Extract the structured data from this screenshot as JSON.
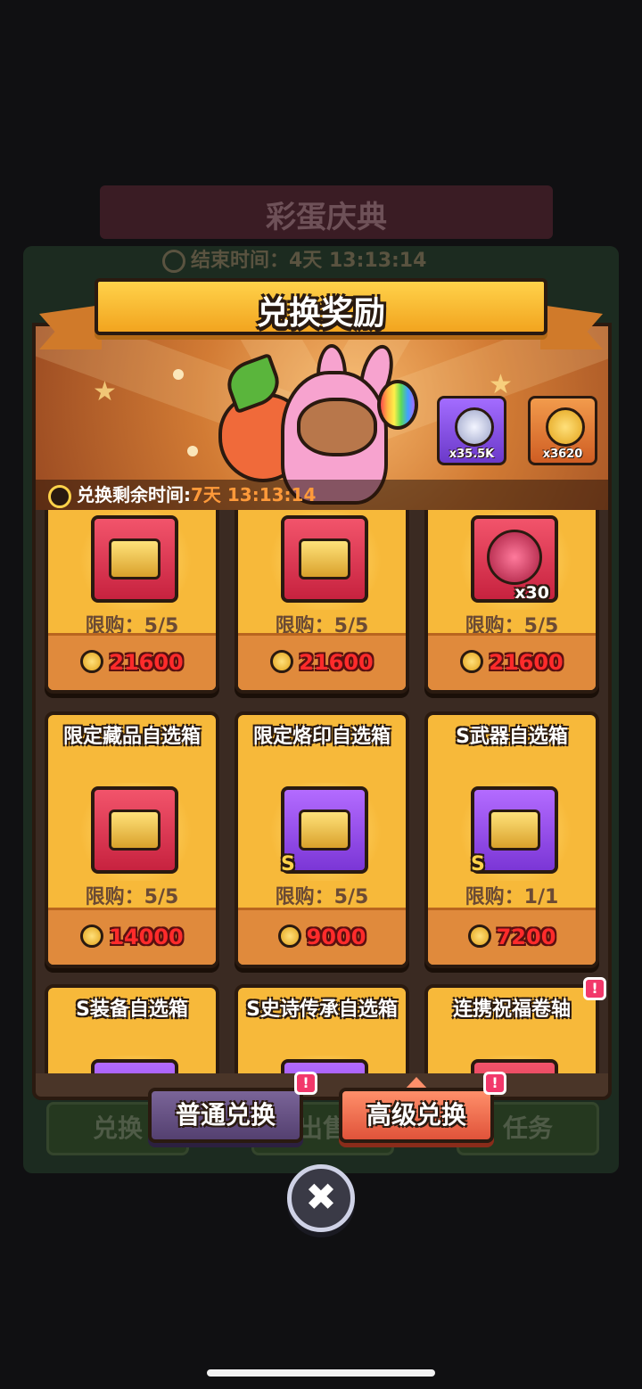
{
  "background": {
    "event_title": "彩蛋庆典",
    "end_time_label": "结束时间：4天 13:13:14",
    "tabs": [
      "兑换",
      "出售",
      "任务"
    ]
  },
  "modal": {
    "title": "兑换奖励",
    "currencies": [
      {
        "icon": "silver-rabbit-coin-icon",
        "amount": "x35.5K"
      },
      {
        "icon": "gold-rabbit-coin-icon",
        "amount": "x3620"
      }
    ],
    "exchange_timer": {
      "label": "兑换剩余时间:",
      "value": "7天 13:13:14"
    }
  },
  "items": [
    {
      "name": "",
      "icon": "collectible-chest-icon",
      "box": "red",
      "badge": "",
      "limit": "限购：5/5",
      "price": "21600"
    },
    {
      "name": "",
      "icon": "collectible-chest-icon",
      "box": "red",
      "badge": "",
      "limit": "限购：5/5",
      "price": "21600"
    },
    {
      "name": "",
      "icon": "orb-token-icon",
      "box": "red",
      "badge": "x30",
      "limit": "限购：5/5",
      "price": "21600"
    },
    {
      "name": "限定藏品自选箱",
      "icon": "limited-collectible-chest-icon",
      "box": "red",
      "badge": "",
      "limit": "限购：5/5",
      "price": "14000"
    },
    {
      "name": "限定烙印自选箱",
      "icon": "limited-brand-chest-icon",
      "box": "purple",
      "badge": "S",
      "limit": "限购：5/5",
      "price": "9000"
    },
    {
      "name": "S武器自选箱",
      "icon": "weapon-chest-icon",
      "box": "purple",
      "badge": "S",
      "limit": "限购：1/1",
      "price": "7200"
    },
    {
      "name": "S装备自选箱",
      "icon": "gear-chest-icon",
      "box": "purple",
      "badge": "",
      "limit": "",
      "price": ""
    },
    {
      "name": "S史诗传承自选箱",
      "icon": "epic-chest-icon",
      "box": "purple",
      "badge": "",
      "limit": "",
      "price": ""
    },
    {
      "name": "连携祝福卷轴",
      "icon": "scroll-icon",
      "box": "red",
      "badge": "",
      "limit": "",
      "price": ""
    }
  ],
  "tabs": {
    "normal": "普通兑换",
    "advanced": "高级兑换",
    "alert_mark": "!"
  },
  "close_label": "✖",
  "colors": {
    "card": "#f7b93a",
    "price_text": "#ff2b2b",
    "timer_value": "#ff9a3a",
    "ribbon": "#ffd24a"
  }
}
